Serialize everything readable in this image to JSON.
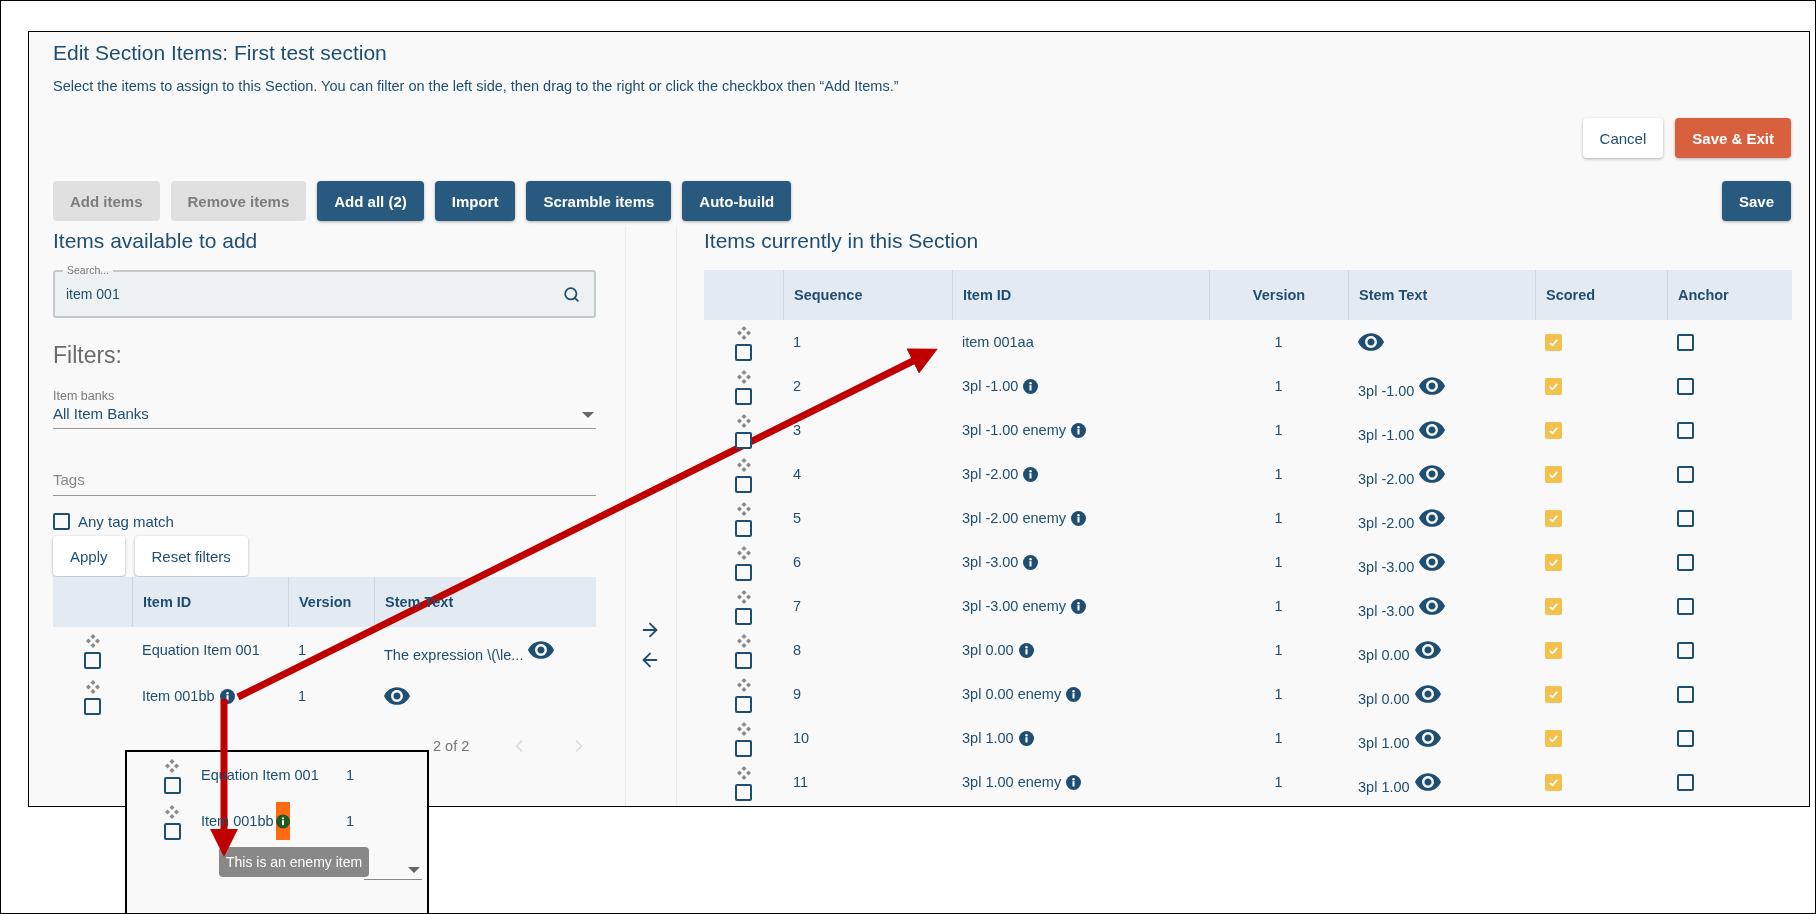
{
  "page": {
    "title": "Edit Section Items: First test section",
    "description": "Select the items to assign to this Section. You can filter on the left side, then drag to the right or click the checkbox then “Add Items.”"
  },
  "actions": [
    {
      "label": "Cancel",
      "kind": "secondary"
    },
    {
      "label": "Save & Exit",
      "kind": "accent"
    }
  ],
  "toolbar": [
    {
      "label": "Add items",
      "disabled": true
    },
    {
      "label": "Remove items",
      "disabled": true
    },
    {
      "label": "Add all (2)",
      "disabled": false
    },
    {
      "label": "Import",
      "disabled": false
    },
    {
      "label": "Scramble items",
      "disabled": false
    },
    {
      "label": "Auto-build",
      "disabled": false
    }
  ],
  "save_button": {
    "label": "Save"
  },
  "available": {
    "heading": "Items available to add",
    "search": {
      "label": "Search...",
      "value": "item 001"
    },
    "filters_heading": "Filters:",
    "item_banks": {
      "label": "Item banks",
      "value": "All Item Banks"
    },
    "tags": {
      "placeholder": "Tags"
    },
    "any_tag_match": {
      "label": "Any tag match",
      "checked": false
    },
    "buttons": [
      "Apply",
      "Reset filters"
    ],
    "table": {
      "columns": [
        "Item ID",
        "Version",
        "Stem Text"
      ],
      "rows": [
        {
          "item_id": "Equation Item 001",
          "info": false,
          "version": "1",
          "stem_text": "The expression \\(\\le...",
          "checked": false
        },
        {
          "item_id": "Item 001bb",
          "info": true,
          "version": "1",
          "checked": false
        }
      ]
    },
    "pagination": "2 of 2"
  },
  "current": {
    "heading": "Items currently in this Section",
    "table": {
      "columns": [
        "Sequence",
        "Item ID",
        "Version",
        "Stem Text",
        "Scored",
        "Anchor"
      ],
      "rows": [
        {
          "sequence": "1",
          "item_id": "item 001aa",
          "info": false,
          "version": "1",
          "scored": true,
          "anchor": false,
          "checked": false
        },
        {
          "sequence": "2",
          "item_id": "3pl -1.00",
          "info": true,
          "version": "1",
          "stem_text": "3pl -1.00",
          "scored": true,
          "anchor": false,
          "checked": false
        },
        {
          "sequence": "3",
          "item_id": "3pl -1.00 enemy",
          "info": true,
          "version": "1",
          "stem_text": "3pl -1.00",
          "scored": true,
          "anchor": false,
          "checked": false
        },
        {
          "sequence": "4",
          "item_id": "3pl -2.00",
          "info": true,
          "version": "1",
          "stem_text": "3pl -2.00",
          "scored": true,
          "anchor": false,
          "checked": false
        },
        {
          "sequence": "5",
          "item_id": "3pl -2.00 enemy",
          "info": true,
          "version": "1",
          "stem_text": "3pl -2.00",
          "scored": true,
          "anchor": false,
          "checked": false
        },
        {
          "sequence": "6",
          "item_id": "3pl -3.00",
          "info": true,
          "version": "1",
          "stem_text": "3pl -3.00",
          "scored": true,
          "anchor": false,
          "checked": false
        },
        {
          "sequence": "7",
          "item_id": "3pl -3.00 enemy",
          "info": true,
          "version": "1",
          "stem_text": "3pl -3.00",
          "scored": true,
          "anchor": false,
          "checked": false
        },
        {
          "sequence": "8",
          "item_id": "3pl 0.00",
          "info": true,
          "version": "1",
          "stem_text": "3pl 0.00",
          "scored": true,
          "anchor": false,
          "checked": false
        },
        {
          "sequence": "9",
          "item_id": "3pl 0.00 enemy",
          "info": true,
          "version": "1",
          "stem_text": "3pl 0.00",
          "scored": true,
          "anchor": false,
          "checked": false
        },
        {
          "sequence": "10",
          "item_id": "3pl 1.00",
          "info": true,
          "version": "1",
          "stem_text": "3pl 1.00",
          "scored": true,
          "anchor": false,
          "checked": false
        },
        {
          "sequence": "11",
          "item_id": "3pl 1.00 enemy",
          "info": true,
          "version": "1",
          "stem_text": "3pl 1.00",
          "scored": true,
          "anchor": false,
          "checked": false
        }
      ]
    }
  },
  "inset": {
    "rows": [
      {
        "item_id": "Equation Item 001",
        "info": false,
        "highlighted": false,
        "version": "1",
        "checked": false
      },
      {
        "item_id": "Item 001bb",
        "info": true,
        "highlighted": true,
        "version": "1",
        "checked": false
      }
    ],
    "tooltip": "This is an enemy item"
  }
}
